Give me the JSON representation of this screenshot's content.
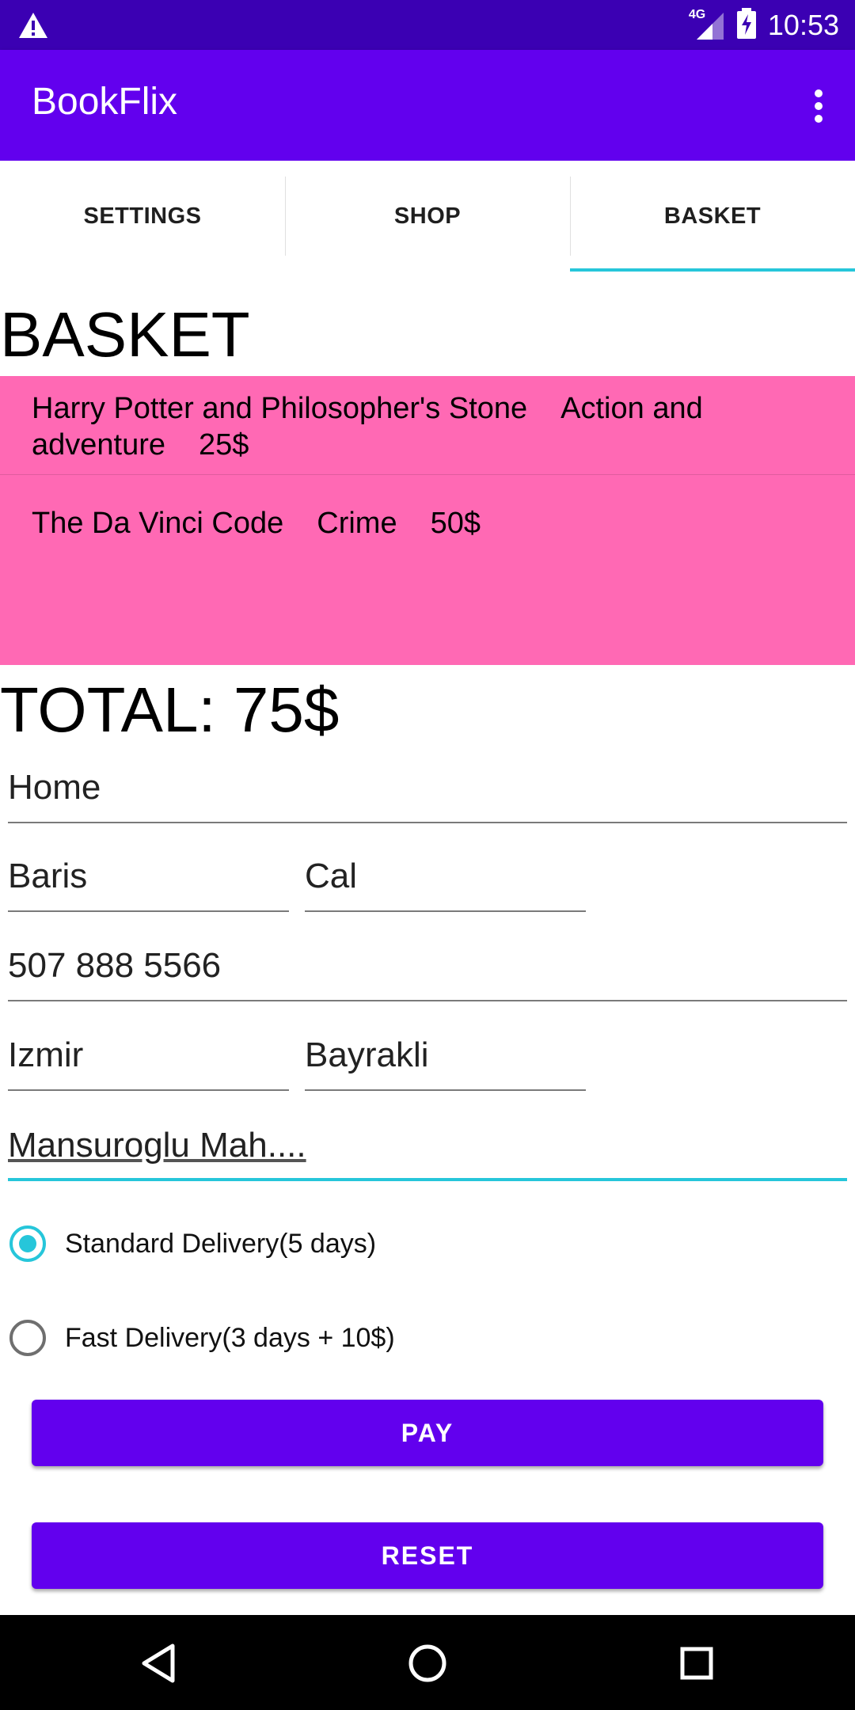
{
  "status_bar": {
    "network": "4G",
    "time": "10:53",
    "icons": [
      "warning-icon",
      "signal-icon",
      "battery-charging-icon"
    ]
  },
  "app_bar": {
    "title": "BookFlix",
    "menu_icon": "more-vert-icon"
  },
  "tabs": [
    {
      "label": "SETTINGS",
      "active": false
    },
    {
      "label": "SHOP",
      "active": false
    },
    {
      "label": "BASKET",
      "active": true
    }
  ],
  "basket": {
    "heading": "BASKET",
    "items": [
      {
        "title": "Harry Potter and Philosopher's Stone",
        "genre": "Action and adventure",
        "price": "25$"
      },
      {
        "title": "The Da Vinci Code",
        "genre": "Crime",
        "price": "50$"
      }
    ],
    "total": "TOTAL: 75$"
  },
  "form": {
    "address_title": "Home",
    "first_name": "Baris",
    "last_name": "Cal",
    "phone": "507 888 5566",
    "city": "Izmir",
    "district": "Bayrakli",
    "address": "Mansuroglu Mah...."
  },
  "delivery": {
    "standard": {
      "label": "Standard Delivery(5 days)",
      "selected": true
    },
    "fast": {
      "label": "Fast Delivery(3 days + 10$)",
      "selected": false
    }
  },
  "buttons": {
    "pay": "PAY",
    "reset": "RESET"
  },
  "colors": {
    "status_bar": "#3b00b3",
    "app_bar": "#6200ee",
    "accent": "#26c6da",
    "basket_bg": "#ff69b4",
    "button": "#6200ee"
  },
  "nav_bar": {
    "icons": [
      "back-icon",
      "home-icon",
      "recents-icon"
    ]
  }
}
